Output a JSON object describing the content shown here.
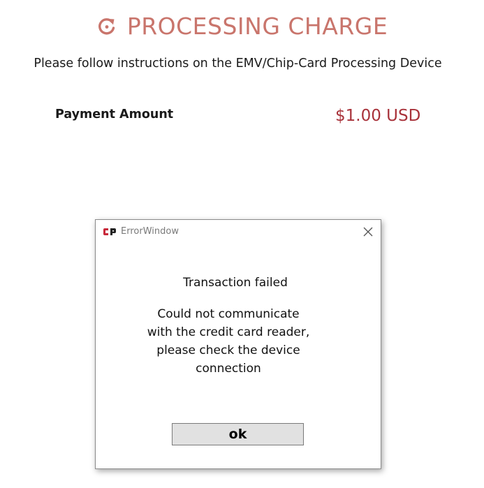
{
  "header": {
    "title": "PROCESSING CHARGE",
    "icon": "refresh-icon",
    "accent_color": "#c9756c"
  },
  "instructions": "Please follow instructions on the EMV/Chip-Card Processing Device",
  "payment": {
    "label": "Payment Amount",
    "amount": "$1.00 USD",
    "amount_color": "#a8323a"
  },
  "error_dialog": {
    "window_title": "ErrorWindow",
    "logo_icon": "cp-logo-icon",
    "close_icon": "close-icon",
    "message_title": "Transaction failed",
    "message_lines": [
      "Could not communicate",
      "with the credit card reader,",
      "please check the device",
      "connection"
    ],
    "ok_label": "ok"
  }
}
